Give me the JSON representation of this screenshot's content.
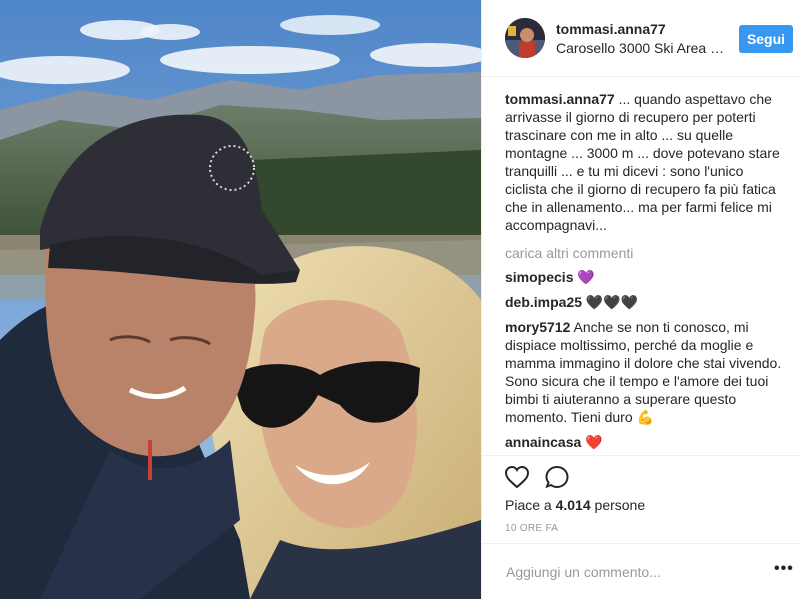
{
  "post": {
    "username": "tommasi.anna77",
    "location": "Carosello 3000 Ski Area L...",
    "follow_label": "Segui",
    "caption_user": "tommasi.anna77",
    "caption_text": " ... quando aspettavo che arrivasse il giorno di recupero per poterti trascinare con me in alto ... su quelle montagne ... 3000 m ... dove potevano stare tranquilli ... e tu mi dicevi : sono l'unico ciclista che il giorno di recupero fa più fatica che in allenamento... ma per farmi felice mi accompagnavi...",
    "load_more": "carica altri commenti",
    "comments": [
      {
        "user": "simopecis",
        "text": " 💜"
      },
      {
        "user": "deb.impa25",
        "text": " 🖤🖤🖤"
      },
      {
        "user": "mory5712",
        "text": " Anche se non ti conosco, mi dispiace moltissimo, perché da moglie e mamma immagino il dolore che stai vivendo. Sono sicura che il tempo e l'amore dei tuoi bimbi ti aiuteranno a superare questo momento. Tieni duro 💪"
      },
      {
        "user": "annaincasa",
        "text": " ❤️"
      }
    ],
    "likes_prefix": "Piace a ",
    "likes_count": "4.014",
    "likes_suffix": " persone",
    "time_ago": "10 ORE FA",
    "comment_placeholder": "Aggiungi un commento...",
    "more_icon": "more-options-icon",
    "icons": [
      "heart-icon",
      "comment-icon"
    ],
    "colors": {
      "accent": "#3897f0",
      "text": "#262626",
      "muted": "#999999"
    }
  }
}
